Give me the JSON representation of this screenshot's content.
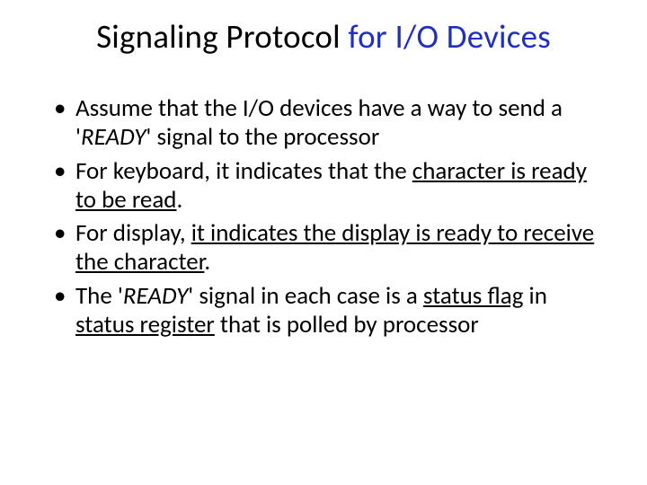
{
  "title": {
    "part1": "Signaling Protocol ",
    "part2": "for I/O Devices"
  },
  "bullets": {
    "b1": {
      "t1": "Assume that the I/O devices have a way to send a ",
      "q1": "'",
      "ready": "READY",
      "q2": "'",
      "t2": " signal to the processor"
    },
    "b2": {
      "t1": "For keyboard, it indicates that the ",
      "u1": "character is ready to be read",
      "t2": "."
    },
    "b3": {
      "t1": "For display, ",
      "u1": "it indicates the display is ready to receive the character",
      "t2": "."
    },
    "b4": {
      "t1": "The ",
      "q1": "'",
      "ready": "READY",
      "q2": "'",
      "t2": " signal in each case is a ",
      "u1": "status flag",
      "t3": " in ",
      "u2": "status register",
      "t4": " that is polled by processor"
    }
  }
}
